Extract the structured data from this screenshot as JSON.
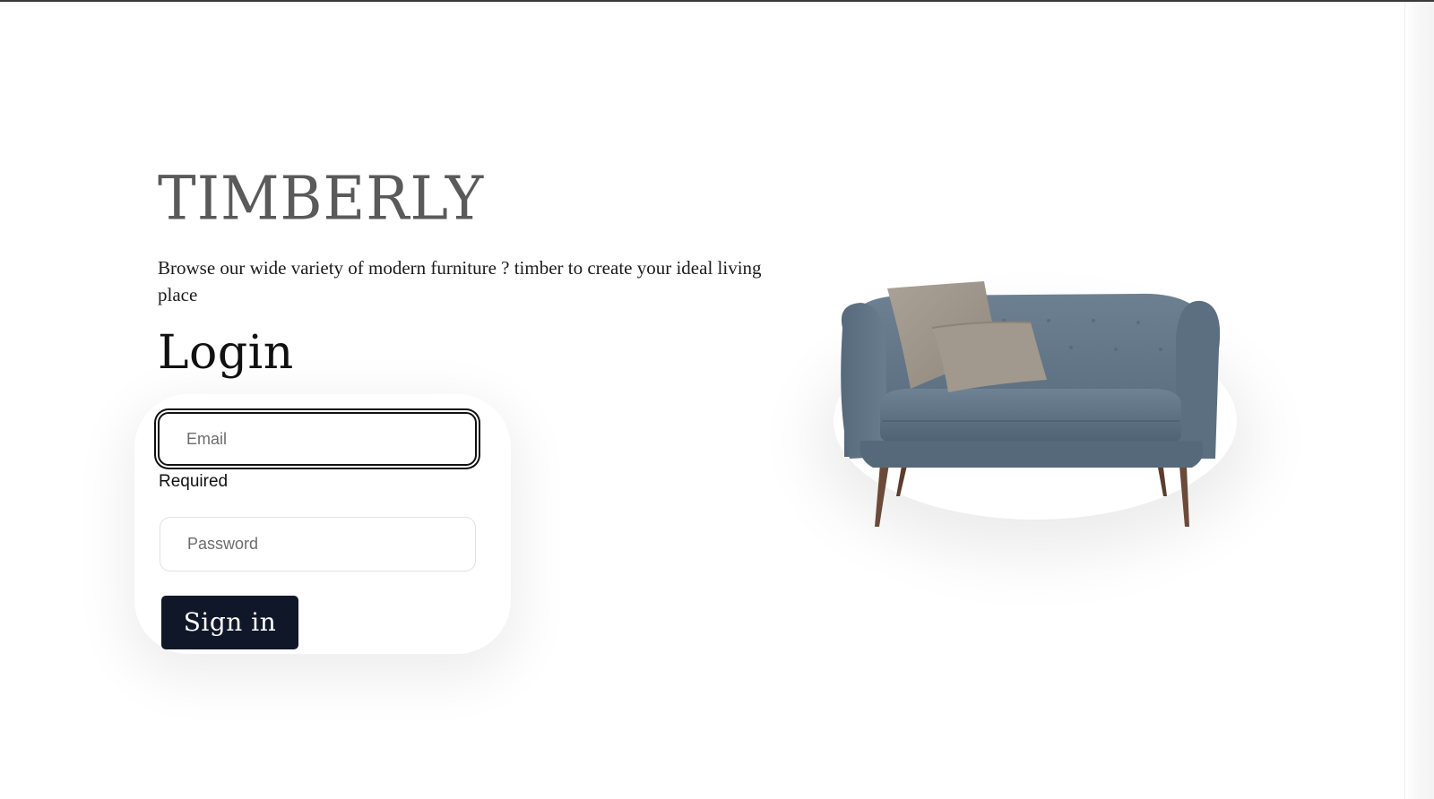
{
  "brand": {
    "name": "TIMBERLY",
    "tagline": "Browse our wide variety of modern furniture ? timber to create your ideal living place"
  },
  "login": {
    "heading": "Login",
    "email": {
      "placeholder": "Email",
      "value": "",
      "validation_message": "Required"
    },
    "password": {
      "placeholder": "Password",
      "value": ""
    },
    "submit_label": "Sign in"
  },
  "hero_image": {
    "icon": "sofa-illustration"
  },
  "colors": {
    "brand_text": "#5a5a5a",
    "button_bg": "#101728",
    "button_text": "#ffffff",
    "sofa_fabric": "#5f7283",
    "cushion": "#a39b90",
    "legs": "#6b4a39"
  }
}
